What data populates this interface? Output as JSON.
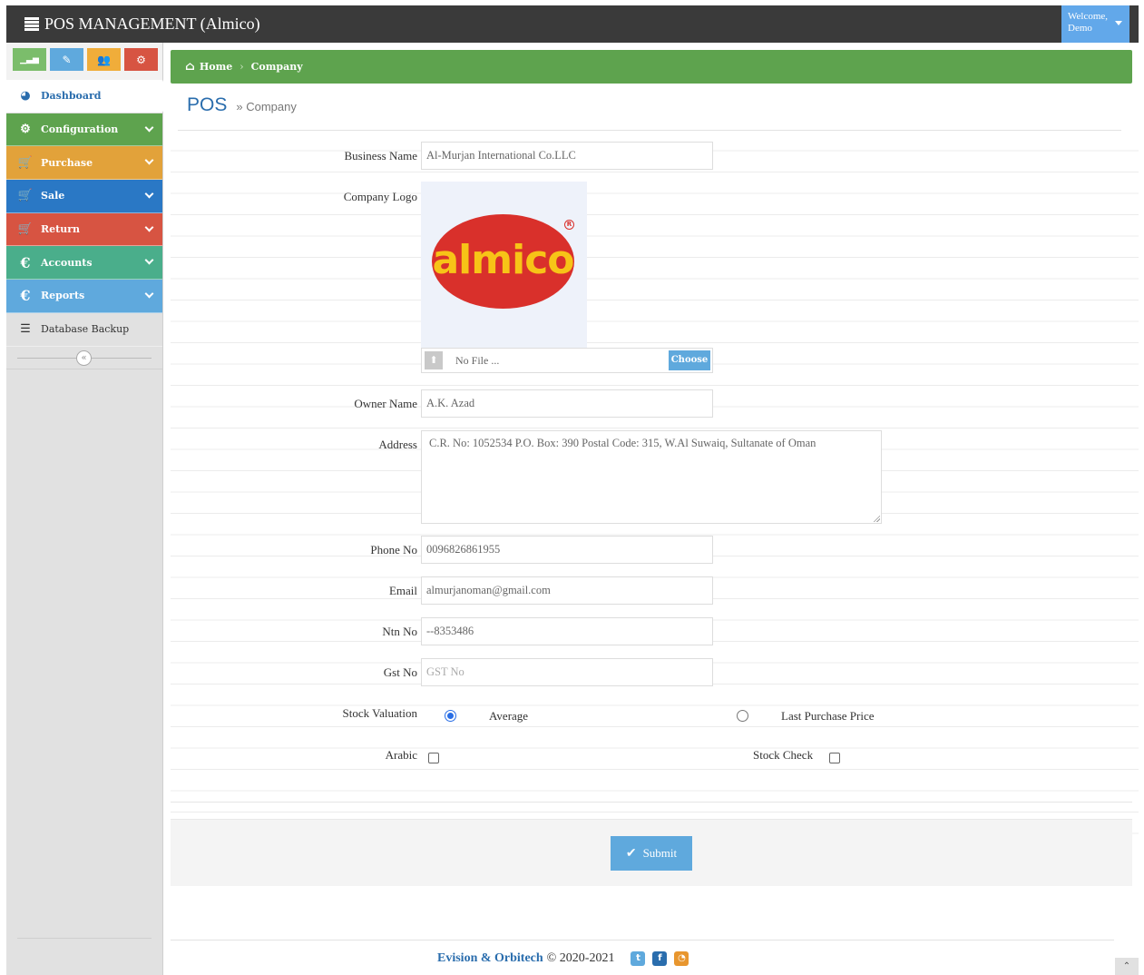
{
  "app": {
    "title": "POS MANAGEMENT (Almico)",
    "welcome_line1": "Welcome,",
    "welcome_line2": "Demo"
  },
  "sidebar": {
    "shortcuts": [
      {
        "icon": "signal-icon",
        "color": "#7bbd6b"
      },
      {
        "icon": "pencil-icon",
        "color": "#5fa9dd"
      },
      {
        "icon": "users-icon",
        "color": "#f0ad3a"
      },
      {
        "icon": "cogs-icon",
        "color": "#d75442"
      }
    ],
    "items": [
      {
        "label": "Dashboard",
        "icon": "dashboard-icon"
      },
      {
        "label": "Configuration",
        "icon": "cogs-icon"
      },
      {
        "label": "Purchase",
        "icon": "cart-icon"
      },
      {
        "label": "Sale",
        "icon": "cart-icon"
      },
      {
        "label": "Return",
        "icon": "cart-icon"
      },
      {
        "label": "Accounts",
        "icon": "euro-icon"
      },
      {
        "label": "Reports",
        "icon": "euro-icon"
      },
      {
        "label": "Database Backup",
        "icon": "database-icon"
      }
    ]
  },
  "breadcrumb": {
    "home": "Home",
    "current": "Company"
  },
  "page": {
    "title": "POS",
    "subtitle": "» Company"
  },
  "form": {
    "business_name": {
      "label": "Business Name",
      "value": "Al-Murjan International Co.LLC"
    },
    "company_logo": {
      "label": "Company Logo",
      "logo_text": "almico",
      "file_placeholder": "No File ...",
      "choose_label": "Choose"
    },
    "owner_name": {
      "label": "Owner Name",
      "value": "A.K. Azad"
    },
    "address": {
      "label": "Address",
      "value": "C.R. No: 1052534 P.O. Box: 390 Postal Code: 315, W.Al Suwaiq, Sultanate of Oman"
    },
    "phone": {
      "label": "Phone No",
      "value": "0096826861955"
    },
    "email": {
      "label": "Email",
      "value": "almurjanoman@gmail.com"
    },
    "ntn": {
      "label": "Ntn No",
      "value": "--8353486"
    },
    "gst": {
      "label": "Gst No",
      "placeholder": "GST No"
    },
    "stock_valuation": {
      "label": "Stock Valuation",
      "option1": "Average",
      "option2": "Last Purchase Price",
      "selected": "Average"
    },
    "arabic": {
      "label": "Arabic",
      "checked": false
    },
    "stock_check": {
      "label": "Stock Check",
      "checked": false
    },
    "submit_label": "Submit"
  },
  "footer": {
    "brand": "Evision & Orbitech",
    "copyright": "© 2020-2021"
  }
}
